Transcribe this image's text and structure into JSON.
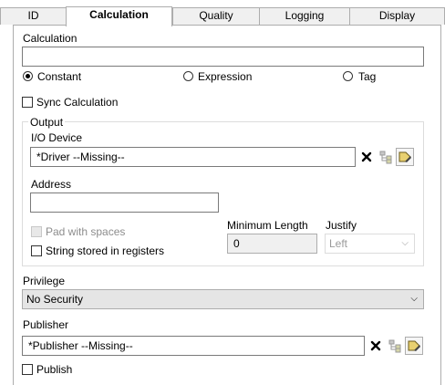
{
  "tabs": [
    "ID",
    "Calculation",
    "Quality",
    "Logging",
    "Display"
  ],
  "calculation": {
    "label": "Calculation",
    "value": "",
    "options": [
      "Constant",
      "Expression",
      "Tag"
    ],
    "selected": "Constant",
    "sync_label": "Sync Calculation",
    "sync_checked": false
  },
  "output": {
    "legend": "Output",
    "io_device_label": "I/O Device",
    "io_device_value": "*Driver    --Missing--",
    "address_label": "Address",
    "address_value": "",
    "pad_label": "Pad with spaces",
    "pad_checked": false,
    "string_registers_label": "String stored in registers",
    "string_registers_checked": false,
    "min_length_label": "Minimum Length",
    "min_length_value": "0",
    "justify_label": "Justify",
    "justify_value": "Left"
  },
  "privilege": {
    "label": "Privilege",
    "value": "No Security"
  },
  "publisher": {
    "label": "Publisher",
    "value": "*Publisher    --Missing--",
    "publish_label": "Publish",
    "publish_checked": false
  },
  "icons": [
    "clear-x-icon",
    "browse-tree-icon",
    "edit-tag-icon"
  ]
}
